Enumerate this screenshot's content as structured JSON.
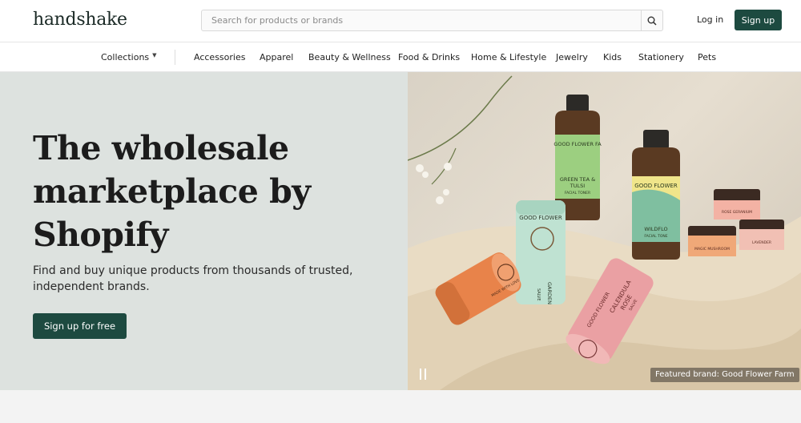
{
  "header": {
    "logo": "handshake",
    "search_placeholder": "Search for products or brands",
    "login_label": "Log in",
    "signup_label": "Sign up"
  },
  "nav": {
    "collections_label": "Collections",
    "items": [
      "Accessories",
      "Apparel",
      "Beauty & Wellness",
      "Food & Drinks",
      "Home & Lifestyle",
      "Jewelry",
      "Kids",
      "Stationery",
      "Pets"
    ]
  },
  "hero": {
    "title_lines": [
      "The wholesale",
      "marketplace by",
      "Shopify"
    ],
    "subtitle_lines": [
      "Find and buy unique products from thousands of trusted,",
      "independent brands."
    ],
    "cta_label": "Sign up for free",
    "featured_caption": "Featured brand: Good Flower Farm",
    "product_labels": {
      "bottle1_brand": "GOOD FLOWER FA",
      "bottle1_name": "GREEN TEA &",
      "bottle1_name2": "TULSI",
      "bottle1_type": "FACIAL TONER",
      "bottle2_brand": "GOOD FLOWER",
      "bottle2_name": "WILDFLO",
      "bottle2_type": "FACIAL TONE",
      "tube1_brand": "GOOD FLOWER",
      "tube1_name": "GARDEN",
      "tube1_type": "SALVE",
      "tube2_brand": "GOOD FLOWER",
      "tube2_name": "CALENDULA",
      "tube2_name2": "ROSE",
      "tube2_type": "SALVE",
      "tube3_text": "MADE WITH LOVE",
      "jar1_name": "ROSE GERANIUM",
      "jar2_name": "MAGIC MUSHROOM",
      "jar3_name": "LAVENDER"
    }
  },
  "colors": {
    "brand_green": "#1d4a40",
    "hero_left_bg": "#dde2df"
  }
}
